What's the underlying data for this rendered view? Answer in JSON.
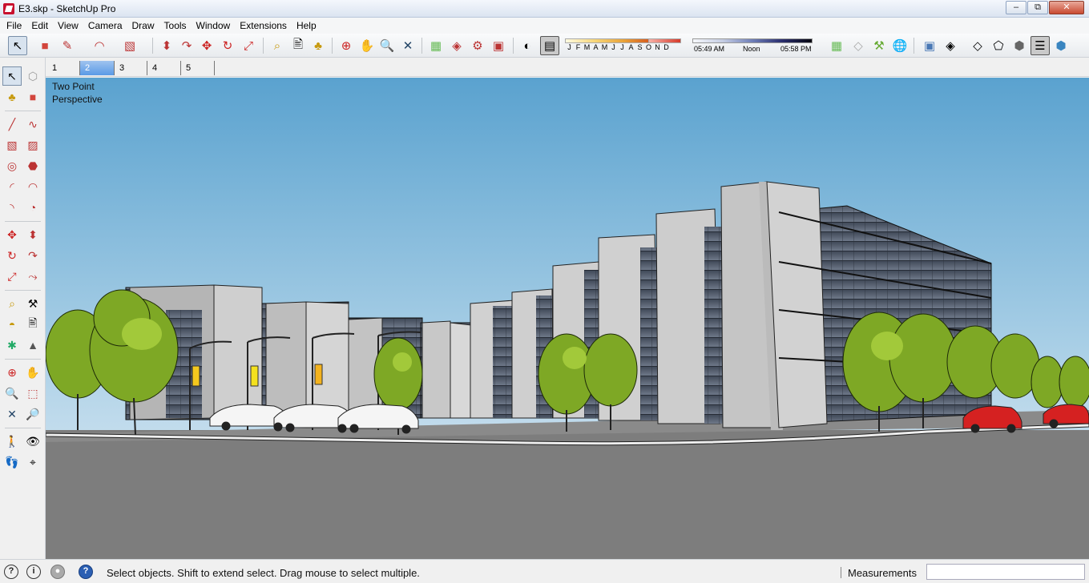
{
  "window": {
    "title": "E3.skp - SketchUp Pro",
    "minimize": "–",
    "maximize": "⧉",
    "close": "✕"
  },
  "menu": [
    "File",
    "Edit",
    "View",
    "Camera",
    "Draw",
    "Tools",
    "Window",
    "Extensions",
    "Help"
  ],
  "shadow": {
    "months": [
      "J",
      "F",
      "M",
      "A",
      "M",
      "J",
      "J",
      "A",
      "S",
      "O",
      "N",
      "D"
    ],
    "time_start": "05:49 AM",
    "time_mid": "Noon",
    "time_end": "05:58 PM"
  },
  "scenes": {
    "tabs": [
      "1",
      "2",
      "3",
      "4",
      "5"
    ],
    "active": "2"
  },
  "viewport": {
    "camera_label_line1": "Two Point",
    "camera_label_line2": "Perspective"
  },
  "status": {
    "message": "Select objects. Shift to extend select. Drag mouse to select multiple.",
    "measurements_label": "Measurements",
    "measurements_value": ""
  },
  "colors": {
    "sky_top": "#5aa2cf",
    "sky_bottom": "#c4dded",
    "ground": "#7d7d7d",
    "concrete": "#b9b9b9",
    "glass": "#4b5566",
    "tree": "#7ea825",
    "car_white": "#f5f5f5",
    "car_red": "#d52121"
  }
}
